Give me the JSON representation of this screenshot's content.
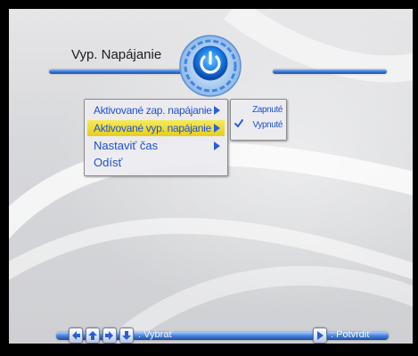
{
  "header": {
    "title": "Vyp. Napájanie",
    "emblem_icon": "power-icon"
  },
  "menu": {
    "items": [
      {
        "label": "Aktivované zap. napájanie",
        "has_submenu": true,
        "selected": false
      },
      {
        "label": "Aktivované vyp. napájanie",
        "has_submenu": true,
        "selected": true
      },
      {
        "label": "Nastaviť čas",
        "has_submenu": true,
        "selected": false
      },
      {
        "label": "Odísť",
        "has_submenu": false,
        "selected": false
      }
    ]
  },
  "submenu": {
    "options": [
      {
        "label": "Zapnuté",
        "checked": false
      },
      {
        "label": "Vypnuté",
        "checked": true
      }
    ]
  },
  "footer": {
    "select_hint": ": Vybrať",
    "confirm_hint": ": Potvrdiť",
    "nav_keys": [
      "left-arrow-icon",
      "up-arrow-icon",
      "right-arrow-icon",
      "down-arrow-icon"
    ],
    "confirm_key": "play-right-icon"
  },
  "colors": {
    "accent_blue": "#2f6fd0",
    "menu_text": "#1f4fd0",
    "highlight_yellow": "#e9d629"
  }
}
